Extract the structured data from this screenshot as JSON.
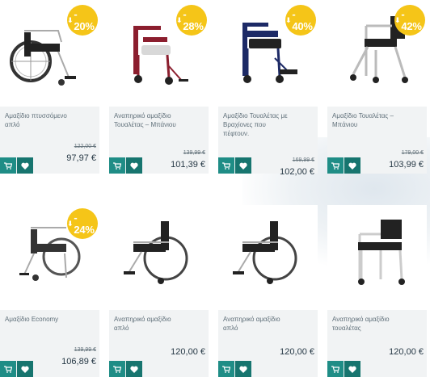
{
  "colors": {
    "badge": "#f5c518",
    "button": "#1f8d86",
    "card_bg": "#f1f3f4"
  },
  "products": [
    {
      "name": "Αμαξίδιο πτυσσόμενο απλό",
      "discount": "- 20%",
      "old_price": "122,00 €",
      "price": "97,97 €"
    },
    {
      "name": "Αναπηρικό αμαξίδιο Τουαλέτας – Μπάνιου",
      "discount": "- 28%",
      "old_price": "139,99 €",
      "price": "101,39 €"
    },
    {
      "name": "Αμαξίδιο Τουαλέτας με Βραχίονες που πέφτουν.",
      "discount": "- 40%",
      "old_price": "169,99 €",
      "price": "102,00 €"
    },
    {
      "name": "Αμαξίδιο Τουαλέτας – Μπάνιου",
      "discount": "- 42%",
      "old_price": "179,00 €",
      "price": "103,99 €"
    },
    {
      "name": "Αμαξίδιο Economy",
      "discount": "- 24%",
      "old_price": "139,99 €",
      "price": "106,89 €"
    },
    {
      "name": "Αναπηρικό αμαξίδιο απλό",
      "discount": "",
      "old_price": "",
      "price": "120,00 €"
    },
    {
      "name": "Αναπηρικό αμαξίδιο απλό",
      "discount": "",
      "old_price": "",
      "price": "120,00 €"
    },
    {
      "name": "Αναπηρικό αμαξίδιο τουαλέτας",
      "discount": "",
      "old_price": "",
      "price": "120,00 €"
    }
  ],
  "icons": {
    "cart": "cart-icon",
    "wishlist": "heart-icon"
  }
}
